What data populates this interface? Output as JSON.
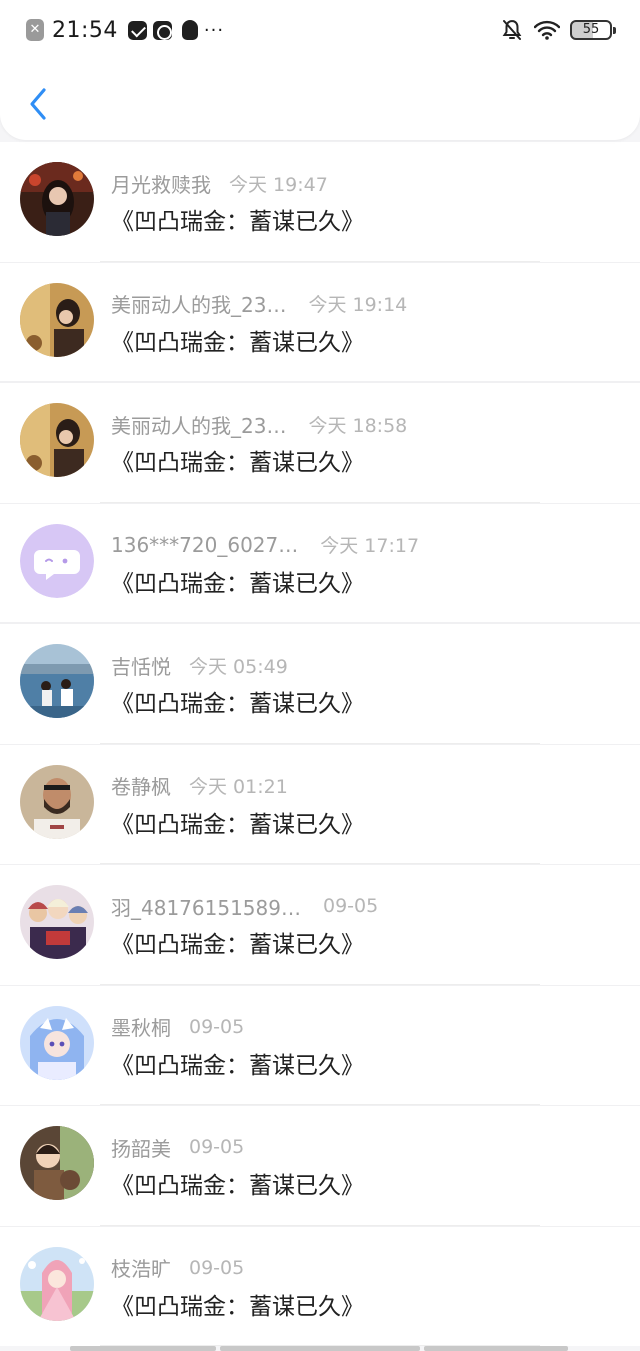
{
  "status_bar": {
    "time": "21:54",
    "close_glyph": "✕",
    "dots": "···",
    "battery": "55"
  },
  "header": {
    "back_icon": "chevron-left-icon"
  },
  "messages": [
    {
      "name": "月光救赎我",
      "time": "今天 19:47",
      "content": "《凹凸瑞金：蓄谋已久》"
    },
    {
      "name": "美丽动人的我_23…",
      "time": "今天 19:14",
      "content": "《凹凸瑞金：蓄谋已久》"
    },
    {
      "name": "美丽动人的我_23…",
      "time": "今天 18:58",
      "content": "《凹凸瑞金：蓄谋已久》"
    },
    {
      "name": "136***720_6027…",
      "time": "今天 17:17",
      "content": "《凹凸瑞金：蓄谋已久》"
    },
    {
      "name": "吉恬悦",
      "time": "今天 05:49",
      "content": "《凹凸瑞金：蓄谋已久》"
    },
    {
      "name": "卷静枫",
      "time": "今天 01:21",
      "content": "《凹凸瑞金：蓄谋已久》"
    },
    {
      "name": "羽_48176151589…",
      "time": "09-05",
      "content": "《凹凸瑞金：蓄谋已久》"
    },
    {
      "name": "墨秋桐",
      "time": "09-05",
      "content": "《凹凸瑞金：蓄谋已久》"
    },
    {
      "name": "扬韶美",
      "time": "09-05",
      "content": "《凹凸瑞金：蓄谋已久》"
    },
    {
      "name": "枝浩旷",
      "time": "09-05",
      "content": "《凹凸瑞金：蓄谋已久》"
    }
  ],
  "colors": {
    "accent": "#2f8ef5",
    "name": "#9b9b9b",
    "time": "#b6b6b6",
    "content": "#222222"
  }
}
